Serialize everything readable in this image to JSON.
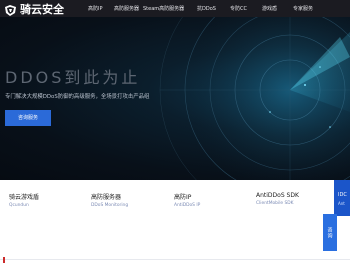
{
  "brand": {
    "name": "骑云安全"
  },
  "nav": {
    "items": [
      {
        "label": "高防IP"
      },
      {
        "label": "高防服务器"
      },
      {
        "label": "Steam高防服务器"
      },
      {
        "label": "抗DDoS"
      },
      {
        "label": "专防CC"
      },
      {
        "label": "游戏盾"
      },
      {
        "label": "专家服务"
      }
    ]
  },
  "hero": {
    "title": "DDOS到此为止",
    "subtitle": "专门解决大规模DDoS防御的高级服务，全场景打攻击产品组",
    "button_label": "咨询服务"
  },
  "products": {
    "items": [
      {
        "title": "骑云游戏盾",
        "subtitle": "Qcundun"
      },
      {
        "title": "高防服务器",
        "subtitle": "DDoS Monitoring"
      },
      {
        "title": "高防IP",
        "subtitle": "AntiDDoS IP"
      },
      {
        "title": "AntiDDoS SDK",
        "subtitle": "ClientMobile SDK"
      }
    ],
    "right_card": {
      "title": "IDC",
      "subtitle": "Ant"
    }
  },
  "float": {
    "consult_label": "咨询"
  },
  "colors": {
    "topbar": "#1b1b21",
    "hero_bg": "#081019",
    "accent_blue": "#2b6ad8",
    "radar_cyan": "#2fa8c8"
  },
  "icons": {
    "logo": "cloud-shield-logo-icon"
  }
}
